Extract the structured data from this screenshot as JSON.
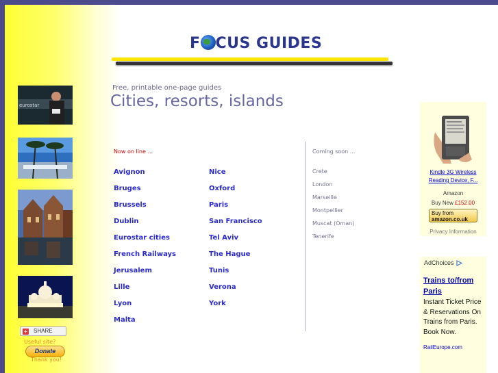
{
  "logo": {
    "text_before": "F",
    "text_after": "CUS GUIDES"
  },
  "intro": {
    "tagline": "Free, printable one-page guides",
    "heading": "Cities, resorts, islands"
  },
  "online": {
    "label": "Now on line ...",
    "col1": [
      "Avignon",
      "Bruges",
      "Brussels",
      "Dublin",
      "Eurostar cities",
      "French Railways",
      "Jerusalem",
      "Lille",
      "Lyon",
      "Malta"
    ],
    "col2": [
      "Nice",
      "Oxford",
      "Paris",
      "San Francisco",
      "Tel Aviv",
      "The Hague",
      "Tunis",
      "Verona",
      "York"
    ]
  },
  "coming_soon": {
    "label": "Coming soon ...",
    "items": [
      "Crete",
      "London",
      "Marseille",
      "Montpellier",
      "Muscat (Oman)",
      "Tenerife"
    ]
  },
  "kindle_ad": {
    "title": "Kindle 3G Wireless Reading Device, F...",
    "seller": "Amazon",
    "price_label": "Buy New",
    "price": "£152.00",
    "buy_line1": "Buy from",
    "buy_brand": "amazon.co.uk",
    "privacy": "Privacy Information"
  },
  "rail_ad": {
    "adchoices": "AdChoices",
    "headline_1": "Trains to/from",
    "headline_link": "Paris",
    "body": "Instant Ticket Price & Reservations On Trains from Paris. Book Now.",
    "url": "RailEurope.com"
  },
  "sidebar": {
    "share": "SHARE",
    "useful": "Useful site?",
    "donate": "Donate",
    "thanks": "Thank you!"
  },
  "colors": {
    "accent_yellow": "#ffe600",
    "link_blue": "#2a2acc",
    "heading": "#6666a0",
    "border": "#4a4a8c"
  }
}
